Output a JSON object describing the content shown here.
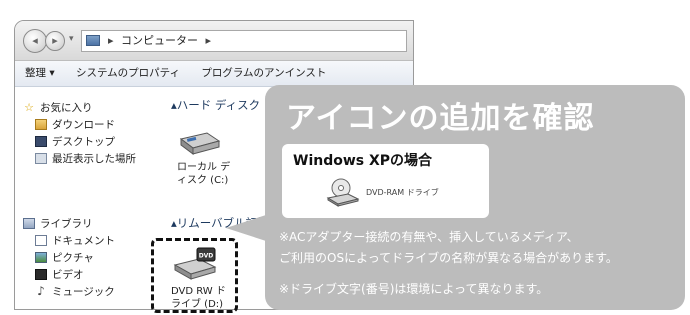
{
  "explorer": {
    "address": {
      "icon": "computer-icon",
      "separator": "▸",
      "location": "コンピューター",
      "trailing_separator": "▸"
    },
    "nav_buttons": {
      "back": "◂",
      "forward": "▸",
      "history": "▾"
    },
    "toolbar": {
      "organize": "整理 ▾",
      "system_properties": "システムのプロパティ",
      "programs": "プログラムのアンインスト"
    },
    "nav_pane": {
      "favorites": {
        "label": "お気に入り",
        "icon": "star-icon",
        "items": [
          {
            "label": "ダウンロード",
            "icon": "downloads-folder-icon"
          },
          {
            "label": "デスクトップ",
            "icon": "desktop-icon"
          },
          {
            "label": "最近表示した場所",
            "icon": "recent-places-icon"
          }
        ]
      },
      "libraries": {
        "label": "ライブラリ",
        "icon": "library-icon",
        "items": [
          {
            "label": "ドキュメント",
            "icon": "documents-icon"
          },
          {
            "label": "ピクチャ",
            "icon": "pictures-icon"
          },
          {
            "label": "ビデオ",
            "icon": "videos-icon"
          },
          {
            "label": "ミュージック",
            "icon": "music-icon"
          }
        ]
      }
    },
    "content": {
      "hard_disk_section": "▴ハード ディスク ドライブ",
      "local_disk": {
        "label_line1": "ローカル デ",
        "label_line2": "ィスク (C:)"
      },
      "removable_section": "▴リムーバブル記憶域があるデバイス",
      "dvd_drive": {
        "label_line1": "DVD RW ド",
        "label_line2": "ライブ (D:)",
        "badge": "DVD"
      }
    }
  },
  "callout": {
    "title": "アイコンの追加を確認",
    "xp_box": {
      "title": "Windows XPの場合",
      "drive_label": "DVD-RAM ドライブ"
    },
    "note1_line1": "※ACアダプター接続の有無や、挿入しているメディア、",
    "note1_line2": "ご利用のOSによってドライブの名称が異なる場合があります。",
    "note2": "※ドライブ文字(番号)は環境によって異なります。"
  },
  "colors": {
    "callout_bg": "#bcbcbc",
    "callout_text": "#ffffff",
    "highlight_border": "#111111"
  }
}
